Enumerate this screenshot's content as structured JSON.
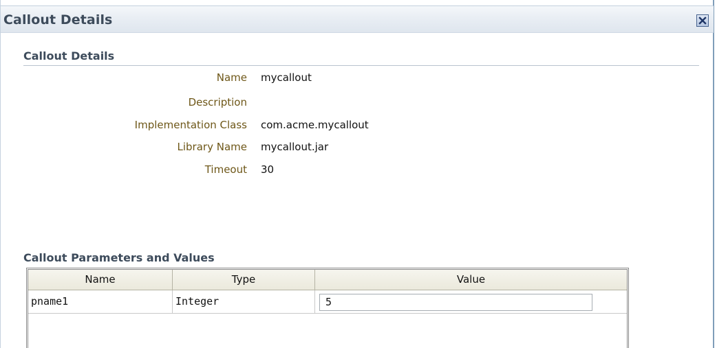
{
  "dialog": {
    "title": "Callout Details",
    "close_icon": "close-icon"
  },
  "details": {
    "section_title": "Callout Details",
    "fields": [
      {
        "label": "Name",
        "value": "mycallout"
      },
      {
        "label": "Description",
        "value": ""
      },
      {
        "label": "Implementation Class",
        "value": "com.acme.mycallout"
      },
      {
        "label": "Library Name",
        "value": "mycallout.jar"
      },
      {
        "label": "Timeout",
        "value": "30"
      }
    ]
  },
  "parameters": {
    "section_title": "Callout Parameters and Values",
    "columns": [
      "Name",
      "Type",
      "Value"
    ],
    "rows": [
      {
        "name": "pname1",
        "type": "Integer",
        "value": "5"
      }
    ]
  },
  "colors": {
    "label": "#6e5718",
    "title": "#3d4b5b",
    "close_border": "#46628e"
  }
}
